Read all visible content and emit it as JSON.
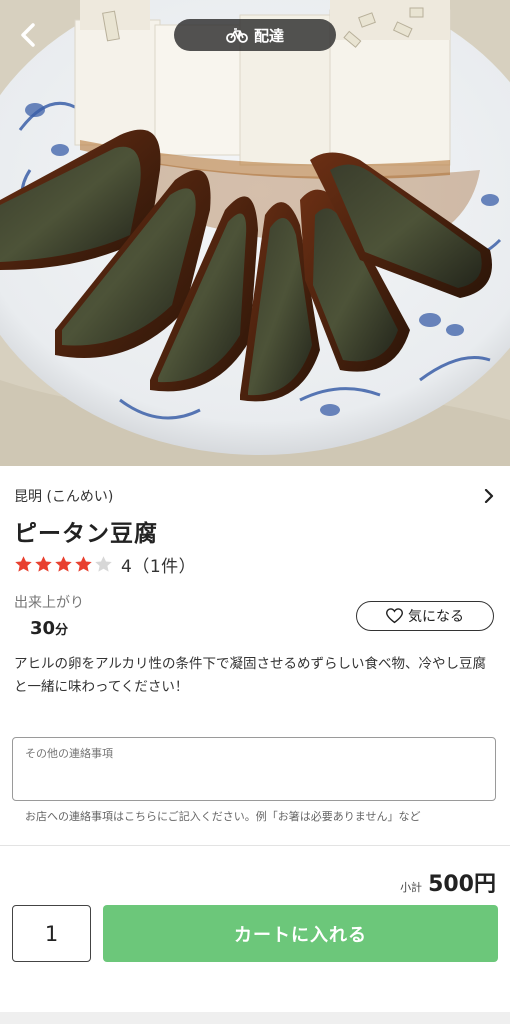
{
  "header": {
    "back_icon": "chevron-left-icon",
    "delivery_icon": "bicycle-icon",
    "delivery_label": "配達"
  },
  "shop": {
    "name": "昆明 (こんめい)",
    "chevron_icon": "chevron-right-icon"
  },
  "item": {
    "title": "ピータン豆腐",
    "rating": {
      "stars": 4,
      "max_stars": 5,
      "text": "4（1件）",
      "star_color": "#e8402f",
      "empty_star_color": "#d7d7d7"
    },
    "prep_time_label": "出来上がり",
    "prep_time_value": "30",
    "prep_time_unit": "分",
    "favorite_label": "気になる",
    "favorite_icon": "heart-outline-icon",
    "description": "アヒルの卵をアルカリ性の条件下で凝固させるめずらしい食べ物、冷やし豆腐と一緒に味わってください！"
  },
  "note": {
    "placeholder": "その他の連絡事項",
    "help_text": "お店への連絡事項はこちらにご記入ください。例「お箸は必要ありません」など"
  },
  "order": {
    "subtotal_label": "小計",
    "subtotal_value": "500円",
    "quantity": "1",
    "add_to_cart_label": "カートに入れる",
    "button_color": "#6cc77a"
  }
}
